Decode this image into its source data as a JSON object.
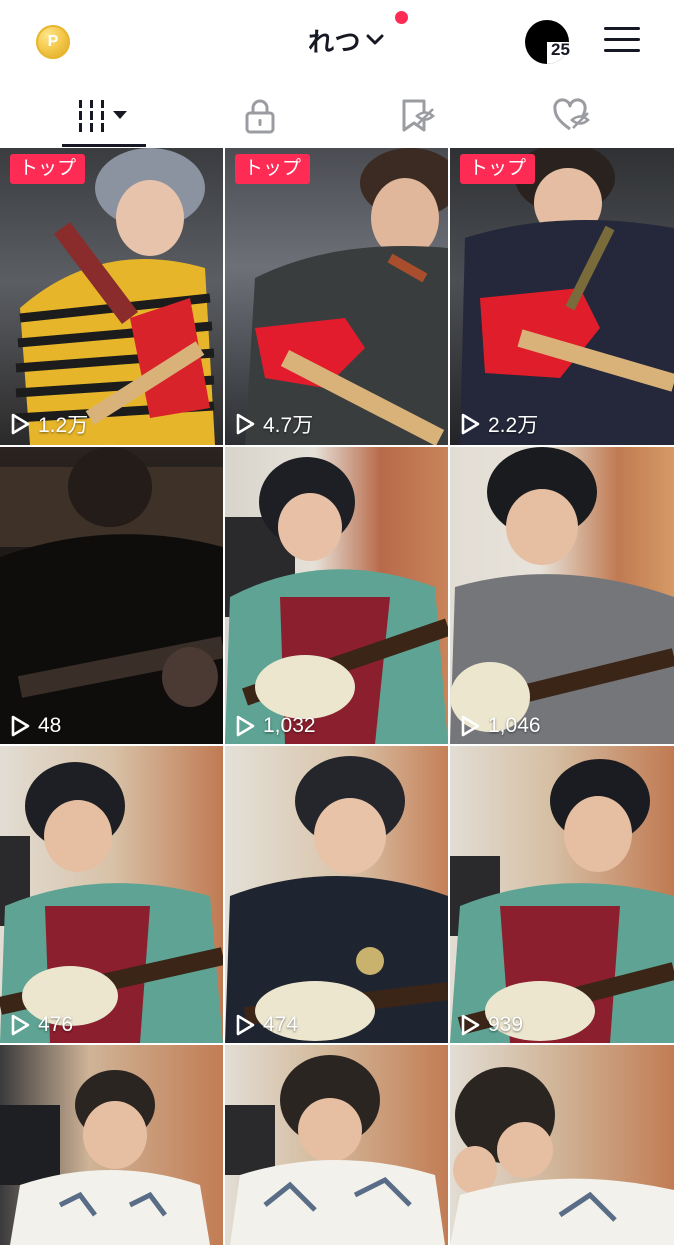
{
  "header": {
    "account_name": "れつ",
    "coin_letter": "P",
    "notification_count": "25"
  },
  "tabs": [
    {
      "icon": "videos-grid-icon",
      "selected": true
    },
    {
      "icon": "lock-icon",
      "selected": false
    },
    {
      "icon": "bookmark-hidden-icon",
      "selected": false
    },
    {
      "icon": "liked-hidden-icon",
      "selected": false
    }
  ],
  "badge_label": "トップ",
  "videos": [
    {
      "views": "1.2万",
      "pinned": true
    },
    {
      "views": "4.7万",
      "pinned": true
    },
    {
      "views": "2.2万",
      "pinned": true
    },
    {
      "views": "48",
      "pinned": false
    },
    {
      "views": "1,032",
      "pinned": false
    },
    {
      "views": "1,046",
      "pinned": false
    },
    {
      "views": "476",
      "pinned": false
    },
    {
      "views": "474",
      "pinned": false
    },
    {
      "views": "939",
      "pinned": false
    },
    {
      "views": "",
      "pinned": false
    },
    {
      "views": "",
      "pinned": false
    },
    {
      "views": "",
      "pinned": false
    }
  ],
  "colors": {
    "accent": "#fe2c55",
    "text": "#161823",
    "icon_gray": "#9b9ca1"
  }
}
